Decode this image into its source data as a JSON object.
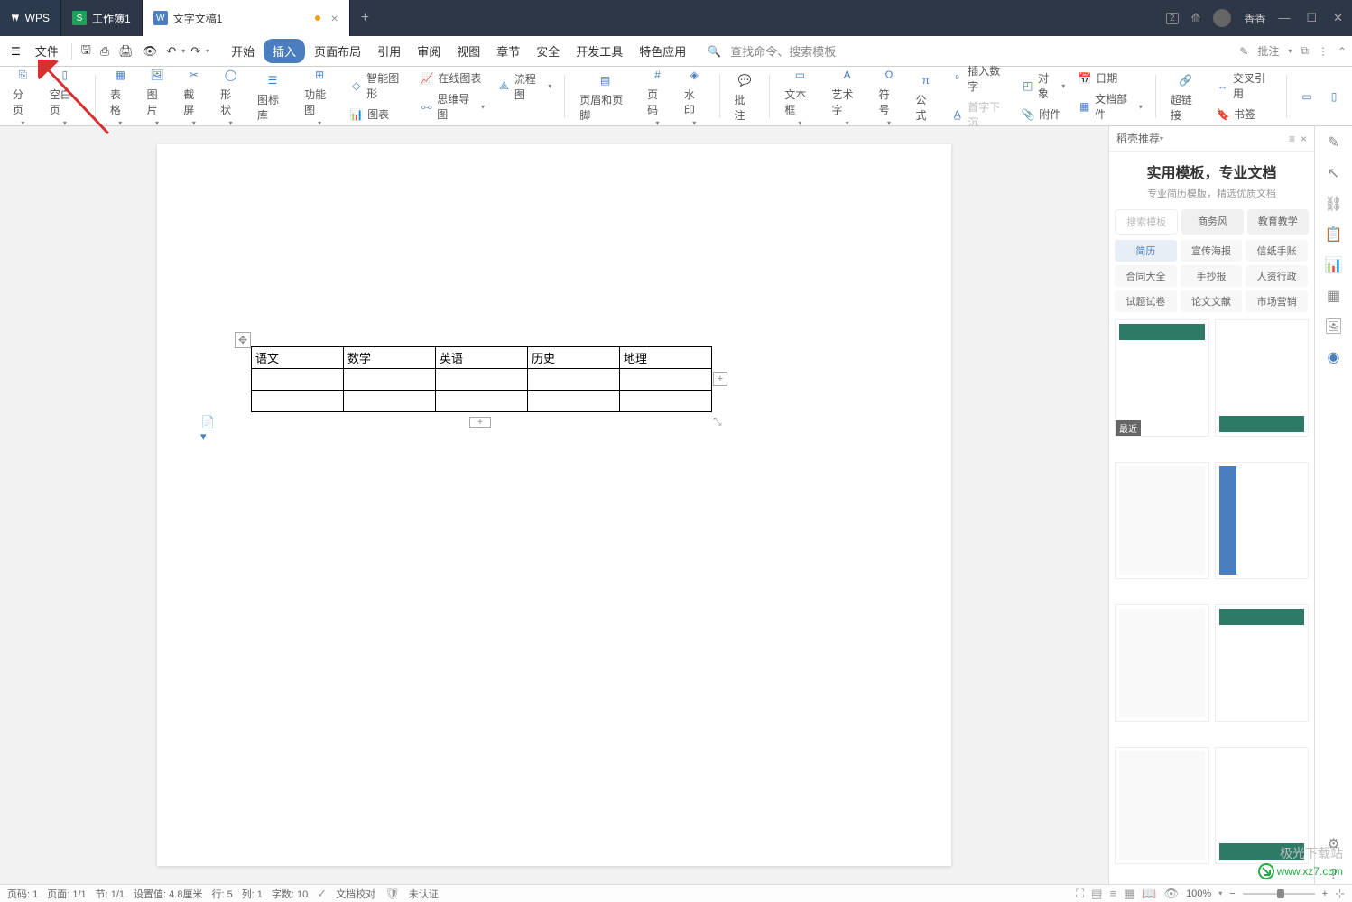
{
  "title_tabs": {
    "wps": "WPS",
    "workbook": "工作簿1",
    "document": "文字文稿1"
  },
  "user": {
    "name": "香香"
  },
  "file_menu": "文件",
  "menus": {
    "start": "开始",
    "insert": "插入",
    "page_layout": "页面布局",
    "references": "引用",
    "review": "审阅",
    "view": "视图",
    "chapter": "章节",
    "security": "安全",
    "dev_tools": "开发工具",
    "special": "特色应用",
    "search": "查找命令、搜索模板"
  },
  "menu_right": {
    "comment": "批注"
  },
  "ribbon": {
    "page_break": "分页",
    "blank_page": "空白页",
    "table": "表格",
    "picture": "图片",
    "screenshot": "截屏",
    "shapes": "形状",
    "icon_library": "图标库",
    "functional": "功能图",
    "smart_graphic": "智能图形",
    "online_chart": "在线图表",
    "flowchart": "流程图",
    "chart": "图表",
    "mindmap": "思维导图",
    "header_footer": "页眉和页脚",
    "page_number": "页码",
    "watermark": "水印",
    "comment": "批注",
    "text_box": "文本框",
    "word_art": "艺术字",
    "symbol": "符号",
    "equation": "公式",
    "insert_number": "插入数字",
    "object": "对象",
    "date": "日期",
    "drop_cap": "首字下沉",
    "attachment": "附件",
    "doc_parts": "文档部件",
    "hyperlink": "超链接",
    "cross_ref": "交叉引用",
    "bookmark": "书签"
  },
  "table_headers": [
    "语文",
    "数学",
    "英语",
    "历史",
    "地理"
  ],
  "sidepanel": {
    "head": "稻壳推荐",
    "title": "实用模板，专业文档",
    "subtitle": "专业简历模版，精选优质文档",
    "search_placeholder": "搜索模板",
    "tab_business": "商务风",
    "tab_education": "教育教学",
    "cats": [
      "简历",
      "宣传海报",
      "信纸手账",
      "合同大全",
      "手抄报",
      "人资行政",
      "试题试卷",
      "论文文献",
      "市场营销"
    ],
    "badge_recent": "最近"
  },
  "statusbar": {
    "page_no": "页码: 1",
    "page": "页面: 1/1",
    "section": "节: 1/1",
    "pos": "设置值: 4.8厘米",
    "row": "行: 5",
    "col": "列: 1",
    "chars": "字数: 10",
    "proof": "文档校对",
    "uncert": "未认证",
    "zoom": "100%"
  },
  "watermark": {
    "line1": "极光下载站",
    "line2": "www.xz7.com"
  }
}
